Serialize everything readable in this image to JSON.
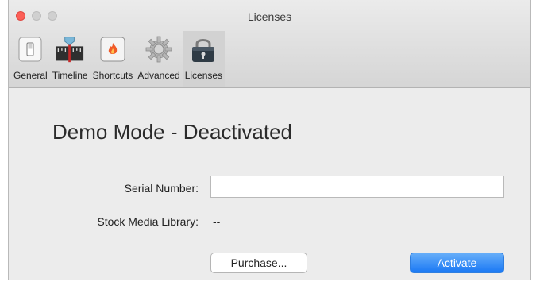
{
  "window": {
    "title": "Licenses"
  },
  "toolbar": {
    "items": [
      {
        "label": "General",
        "icon": "switch-icon",
        "selected": false
      },
      {
        "label": "Timeline",
        "icon": "timeline-icon",
        "selected": false
      },
      {
        "label": "Shortcuts",
        "icon": "flame-key-icon",
        "selected": false
      },
      {
        "label": "Advanced",
        "icon": "gear-icon",
        "selected": false
      },
      {
        "label": "Licenses",
        "icon": "padlock-icon",
        "selected": true
      }
    ]
  },
  "content": {
    "heading": "Demo Mode - Deactivated",
    "serial": {
      "label": "Serial Number:",
      "value": "",
      "placeholder": ""
    },
    "stock": {
      "label": "Stock Media Library:",
      "value": "--"
    },
    "purchase_label": "Purchase...",
    "activate_label": "Activate"
  },
  "colors": {
    "accent": "#1a78f4",
    "close": "#fc5f57",
    "timeline_marker": "#c62828"
  }
}
